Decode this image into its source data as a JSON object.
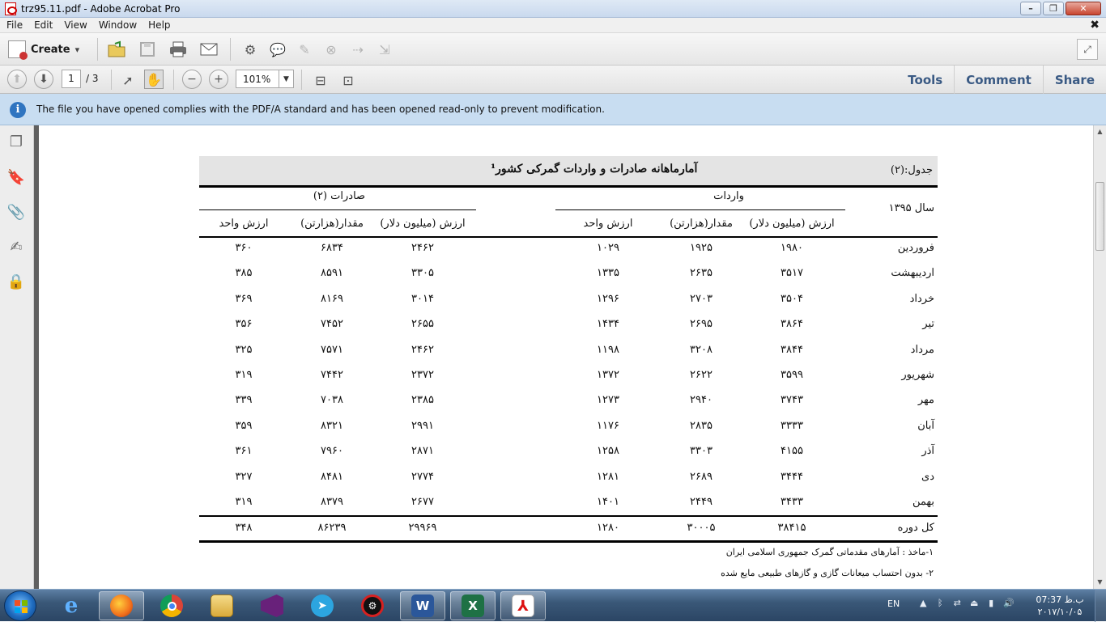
{
  "window": {
    "title": "trz95.11.pdf - Adobe Acrobat Pro",
    "minimize": "–",
    "restore": "❐",
    "close": "✕"
  },
  "menu": [
    "File",
    "Edit",
    "View",
    "Window",
    "Help"
  ],
  "menu_close": "✖",
  "toolbar": {
    "create_label": "Create",
    "create_arrow": "▾"
  },
  "nav": {
    "page_current": "1",
    "page_total": "/ 3",
    "zoom": "101%",
    "zoom_arrow": "▼",
    "links": [
      "Tools",
      "Comment",
      "Share"
    ]
  },
  "infobar": {
    "icon": "i",
    "message": "The file you have opened complies with the PDF/A standard and has been opened read-only to prevent modification."
  },
  "document": {
    "table_label": "جدول:(۲)",
    "table_title": "آمارماهانه صادرات و واردات گمرکی کشور¹",
    "year_label": "سال ۱۳۹۵",
    "imports_header": "واردات",
    "exports_header": "صادرات (۲)",
    "col_value_musd": "ارزش (میلیون دلار)",
    "col_quantity": "مقدار(هزارتن)",
    "col_unit_value": "ارزش واحد",
    "rows": [
      {
        "month": "فروردین",
        "imp_value": "۱۹۸۰",
        "imp_qty": "۱۹۲۵",
        "imp_unit": "۱۰۲۹",
        "exp_value": "۲۴۶۲",
        "exp_qty": "۶۸۳۴",
        "exp_unit": "۳۶۰"
      },
      {
        "month": "اردیبهشت",
        "imp_value": "۳۵۱۷",
        "imp_qty": "۲۶۳۵",
        "imp_unit": "۱۳۳۵",
        "exp_value": "۳۳۰۵",
        "exp_qty": "۸۵۹۱",
        "exp_unit": "۳۸۵"
      },
      {
        "month": "خرداد",
        "imp_value": "۳۵۰۴",
        "imp_qty": "۲۷۰۳",
        "imp_unit": "۱۲۹۶",
        "exp_value": "۳۰۱۴",
        "exp_qty": "۸۱۶۹",
        "exp_unit": "۳۶۹"
      },
      {
        "month": "تیر",
        "imp_value": "۳۸۶۴",
        "imp_qty": "۲۶۹۵",
        "imp_unit": "۱۴۳۴",
        "exp_value": "۲۶۵۵",
        "exp_qty": "۷۴۵۲",
        "exp_unit": "۳۵۶"
      },
      {
        "month": "مرداد",
        "imp_value": "۳۸۴۴",
        "imp_qty": "۳۲۰۸",
        "imp_unit": "۱۱۹۸",
        "exp_value": "۲۴۶۲",
        "exp_qty": "۷۵۷۱",
        "exp_unit": "۳۲۵"
      },
      {
        "month": "شهریور",
        "imp_value": "۳۵۹۹",
        "imp_qty": "۲۶۲۲",
        "imp_unit": "۱۳۷۲",
        "exp_value": "۲۳۷۲",
        "exp_qty": "۷۴۴۲",
        "exp_unit": "۳۱۹"
      },
      {
        "month": "مهر",
        "imp_value": "۳۷۴۳",
        "imp_qty": "۲۹۴۰",
        "imp_unit": "۱۲۷۳",
        "exp_value": "۲۳۸۵",
        "exp_qty": "۷۰۳۸",
        "exp_unit": "۳۳۹"
      },
      {
        "month": "آبان",
        "imp_value": "۳۳۳۳",
        "imp_qty": "۲۸۳۵",
        "imp_unit": "۱۱۷۶",
        "exp_value": "۲۹۹۱",
        "exp_qty": "۸۳۲۱",
        "exp_unit": "۳۵۹"
      },
      {
        "month": "آذر",
        "imp_value": "۴۱۵۵",
        "imp_qty": "۳۳۰۳",
        "imp_unit": "۱۲۵۸",
        "exp_value": "۲۸۷۱",
        "exp_qty": "۷۹۶۰",
        "exp_unit": "۳۶۱"
      },
      {
        "month": "دی",
        "imp_value": "۳۴۴۴",
        "imp_qty": "۲۶۸۹",
        "imp_unit": "۱۲۸۱",
        "exp_value": "۲۷۷۴",
        "exp_qty": "۸۴۸۱",
        "exp_unit": "۳۲۷"
      },
      {
        "month": "بهمن",
        "imp_value": "۳۴۳۳",
        "imp_qty": "۲۴۴۹",
        "imp_unit": "۱۴۰۱",
        "exp_value": "۲۶۷۷",
        "exp_qty": "۸۳۷۹",
        "exp_unit": "۳۱۹"
      }
    ],
    "total": {
      "month": "کل دوره",
      "imp_value": "۳۸۴۱۵",
      "imp_qty": "۳۰۰۰۵",
      "imp_unit": "۱۲۸۰",
      "exp_value": "۲۹۹۶۹",
      "exp_qty": "۸۶۲۳۹",
      "exp_unit": "۳۴۸"
    },
    "footnote1": "۱-ماخذ : آمارهای مقدماتی گمرک جمهوری اسلامی ایران",
    "footnote2": "۲- بدون احتساب میعانات گازی و گازهای طبیعی مایع شده"
  },
  "taskbar": {
    "apps": [
      "ie-icon",
      "firefox-icon",
      "chrome-icon",
      "file-explorer-icon",
      "visual-studio-icon",
      "telegram-icon",
      "antivirus-icon",
      "word-icon",
      "excel-icon",
      "acrobat-icon"
    ],
    "lang": "EN",
    "time": "07:37 ب.ظ",
    "date": "۲۰۱۷/۱۰/۰۵"
  }
}
